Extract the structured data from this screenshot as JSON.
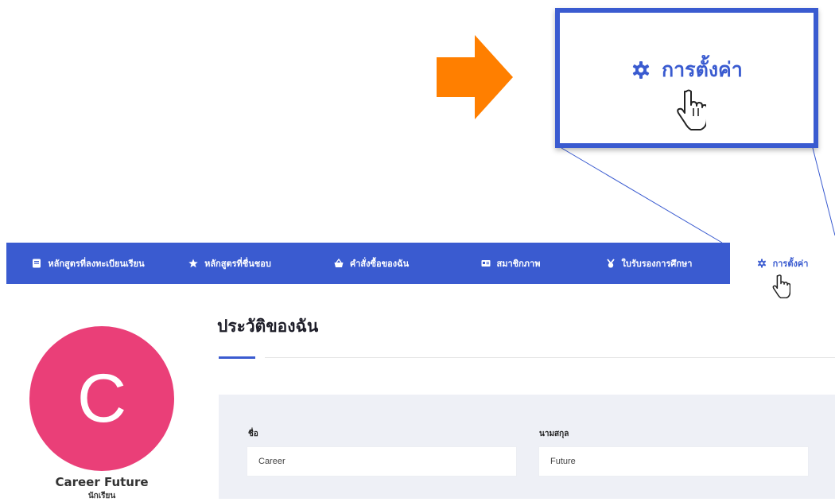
{
  "callout": {
    "label": "การตั้งค่า",
    "icon": "gear-icon",
    "arrow_color": "#ff7f00",
    "box_border_color": "#3a5bd0"
  },
  "nav": {
    "background": "#3a5bd0",
    "items": [
      {
        "label": "หลักสูตรที่ลงทะเบียนเรียน",
        "icon": "book-icon"
      },
      {
        "label": "หลักสูตรที่ชื่นชอบ",
        "icon": "star-icon"
      },
      {
        "label": "คำสั่งซื้อของฉัน",
        "icon": "basket-icon"
      },
      {
        "label": "สมาชิกภาพ",
        "icon": "id-card-icon"
      },
      {
        "label": "ใบรับรองการศึกษา",
        "icon": "certificate-icon"
      },
      {
        "label": "การตั้งค่า",
        "icon": "gear-icon",
        "active": true
      }
    ]
  },
  "profile": {
    "avatar_letter": "C",
    "avatar_color": "#ea3f78",
    "name": "Career Future",
    "role": "นักเรียน"
  },
  "content": {
    "title": "ประวัติของฉัน",
    "form": {
      "first_name_label": "ชื่อ",
      "first_name_value": "Career",
      "last_name_label": "นามสกุล",
      "last_name_value": "Future"
    }
  }
}
